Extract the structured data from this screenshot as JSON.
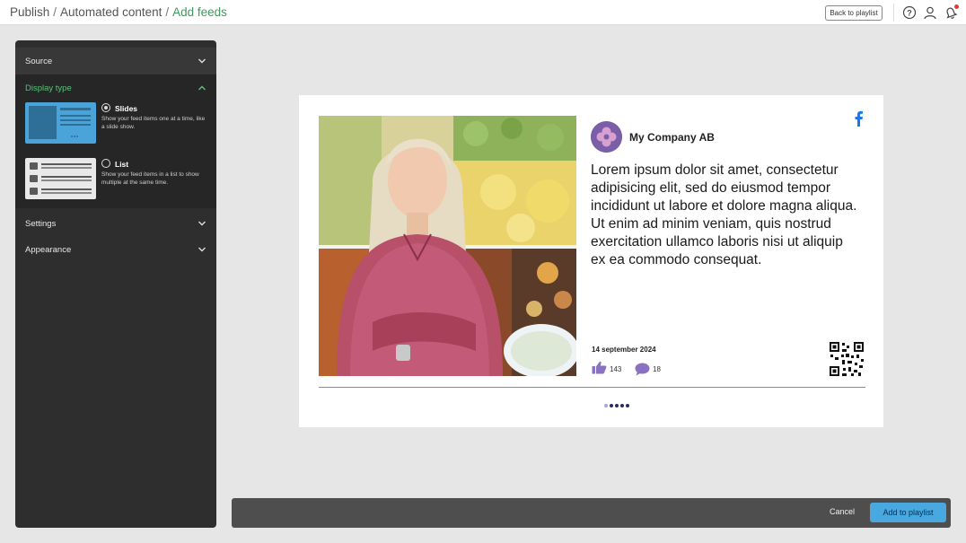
{
  "header": {
    "breadcrumb": [
      {
        "label": "Publish"
      },
      {
        "label": "Automated content"
      },
      {
        "label": "Add feeds"
      }
    ],
    "separator": "/",
    "back_label": "Back to playlist",
    "icons": [
      "help-icon",
      "user-icon",
      "notification-icon"
    ],
    "notification_color": "#e53935"
  },
  "sidebar": {
    "sections": [
      {
        "label": "Source",
        "expanded": false
      },
      {
        "label": "Display type",
        "expanded": true
      },
      {
        "label": "Settings",
        "expanded": false
      },
      {
        "label": "Appearance",
        "expanded": false
      }
    ],
    "display_options": [
      {
        "title": "Slides",
        "description": "Show your feed items one at a time, like a slide show.",
        "selected": true
      },
      {
        "title": "List",
        "description": "Show your feed items in a list to show multiple at the same time.",
        "selected": false
      }
    ]
  },
  "preview": {
    "company": "My Company AB",
    "text": "Lorem ipsum dolor sit amet, consectetur adipisicing elit, sed do eiusmod tempor incididunt ut labore et dolore magna aliqua. Ut enim ad minim veniam, quis nostrud exercitation ullamco laboris nisi ut aliquip ex ea commodo consequat.",
    "date": "14 september 2024",
    "likes": "143",
    "comments": "18",
    "network_icon": "facebook-icon",
    "slide_count": 5,
    "active_slide": 1,
    "colors": {
      "accent": "#7a5fa8",
      "facebook": "#1877f2",
      "divider": "#8a7fc8"
    }
  },
  "actions": {
    "cancel_label": "Cancel",
    "primary_label": "Add to playlist",
    "primary_color": "#4aa8e0"
  }
}
